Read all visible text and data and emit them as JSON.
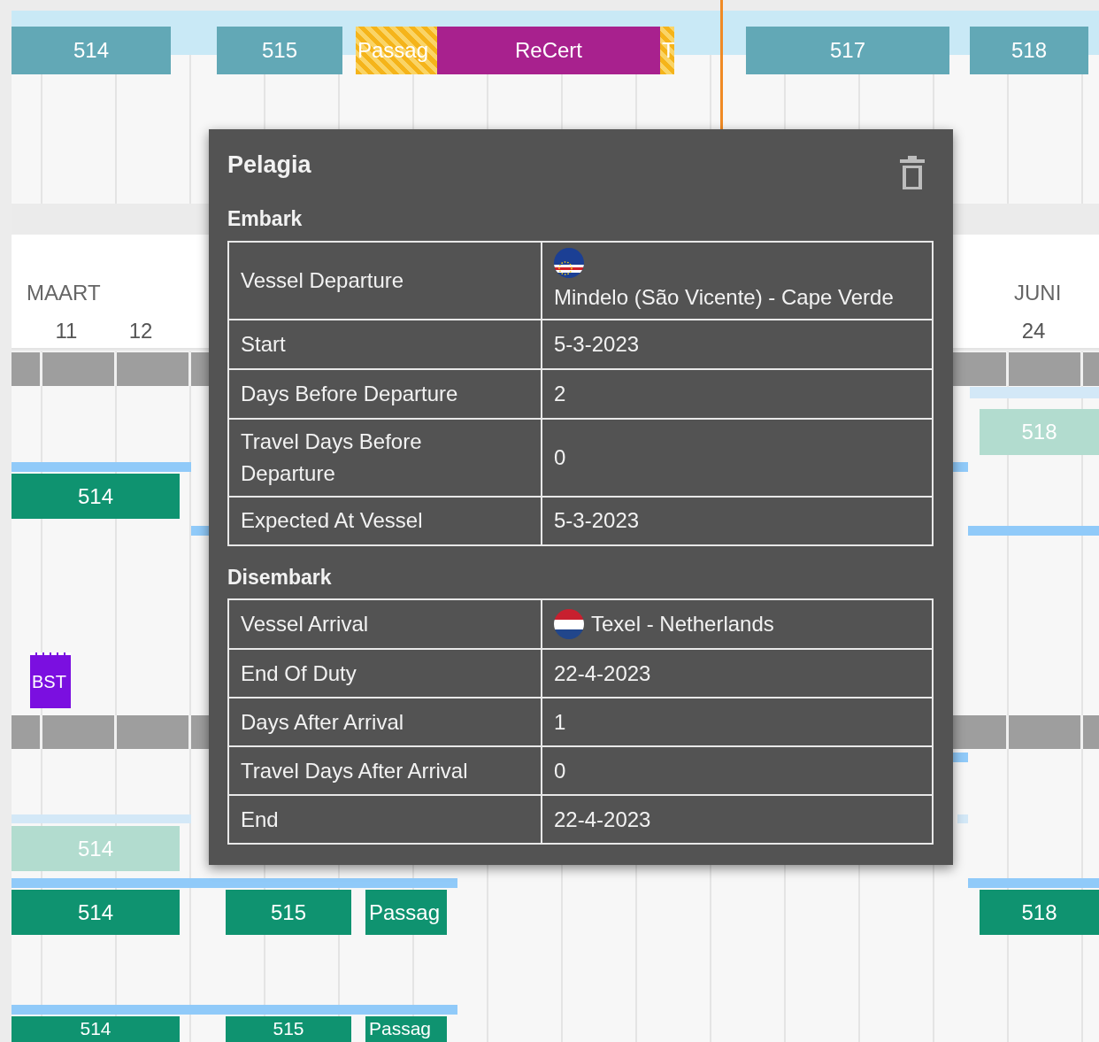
{
  "timeline": {
    "months": [
      "MAART",
      "JUNI"
    ],
    "days": [
      "11",
      "12",
      "24"
    ],
    "bars": [
      {
        "label": "514",
        "kind": "trip"
      },
      {
        "label": "515",
        "kind": "trip"
      },
      {
        "label": "Passag",
        "kind": "passage"
      },
      {
        "label": "ReCert",
        "kind": "recert"
      },
      {
        "label": "T",
        "kind": "passage"
      },
      {
        "label": "517",
        "kind": "trip"
      },
      {
        "label": "518",
        "kind": "trip"
      },
      {
        "label": "518",
        "kind": "tentative"
      },
      {
        "label": "514",
        "kind": "assigned"
      },
      {
        "label": "BST",
        "kind": "course"
      },
      {
        "label": "514",
        "kind": "tentative"
      },
      {
        "label": "514",
        "kind": "assigned"
      },
      {
        "label": "515",
        "kind": "assigned"
      },
      {
        "label": "Passag",
        "kind": "assigned"
      },
      {
        "label": "518",
        "kind": "assigned"
      },
      {
        "label": "514",
        "kind": "assigned"
      },
      {
        "label": "515",
        "kind": "assigned"
      },
      {
        "label": "Passag",
        "kind": "assigned"
      }
    ]
  },
  "popup": {
    "title": "Pelagia",
    "sections": [
      {
        "title": "Embark",
        "rows": [
          {
            "label": "Vessel Departure",
            "value": "Mindelo (São Vicente) - Cape Verde"
          },
          {
            "label": "Start",
            "value": "5-3-2023"
          },
          {
            "label": "Days Before Departure",
            "value": "2"
          },
          {
            "label": "Travel Days Before Departure",
            "value": "0"
          },
          {
            "label": "Expected At Vessel",
            "value": "5-3-2023"
          }
        ]
      },
      {
        "title": "Disembark",
        "rows": [
          {
            "label": "Vessel Arrival",
            "value": "Texel - Netherlands"
          },
          {
            "label": "End Of Duty",
            "value": "22-4-2023"
          },
          {
            "label": "Days After Arrival",
            "value": "1"
          },
          {
            "label": "Travel Days After Arrival",
            "value": "0"
          },
          {
            "label": "End",
            "value": "22-4-2023"
          }
        ]
      }
    ]
  }
}
